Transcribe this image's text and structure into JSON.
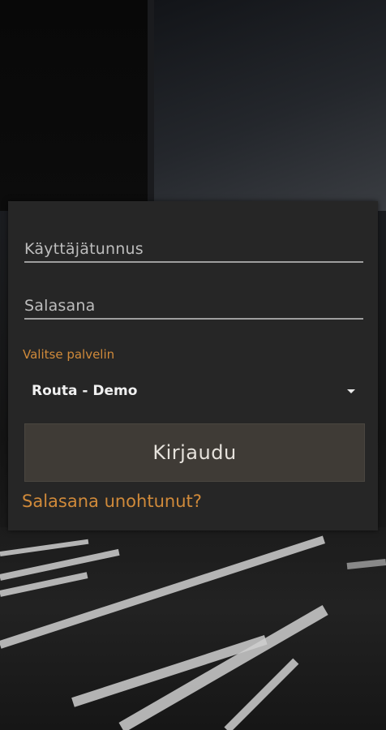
{
  "login": {
    "username_placeholder": "Käyttäjätunnus",
    "password_placeholder": "Salasana",
    "server_label": "Valitse palvelin",
    "server_selected": "Routa - Demo",
    "login_button": "Kirjaudu",
    "forgot_link": "Salasana unohtunut?"
  },
  "colors": {
    "accent": "#d08a3a",
    "panel": "#262626",
    "button": "#3f3b36"
  },
  "icons": {
    "select_caret": "chevron-down-icon"
  }
}
